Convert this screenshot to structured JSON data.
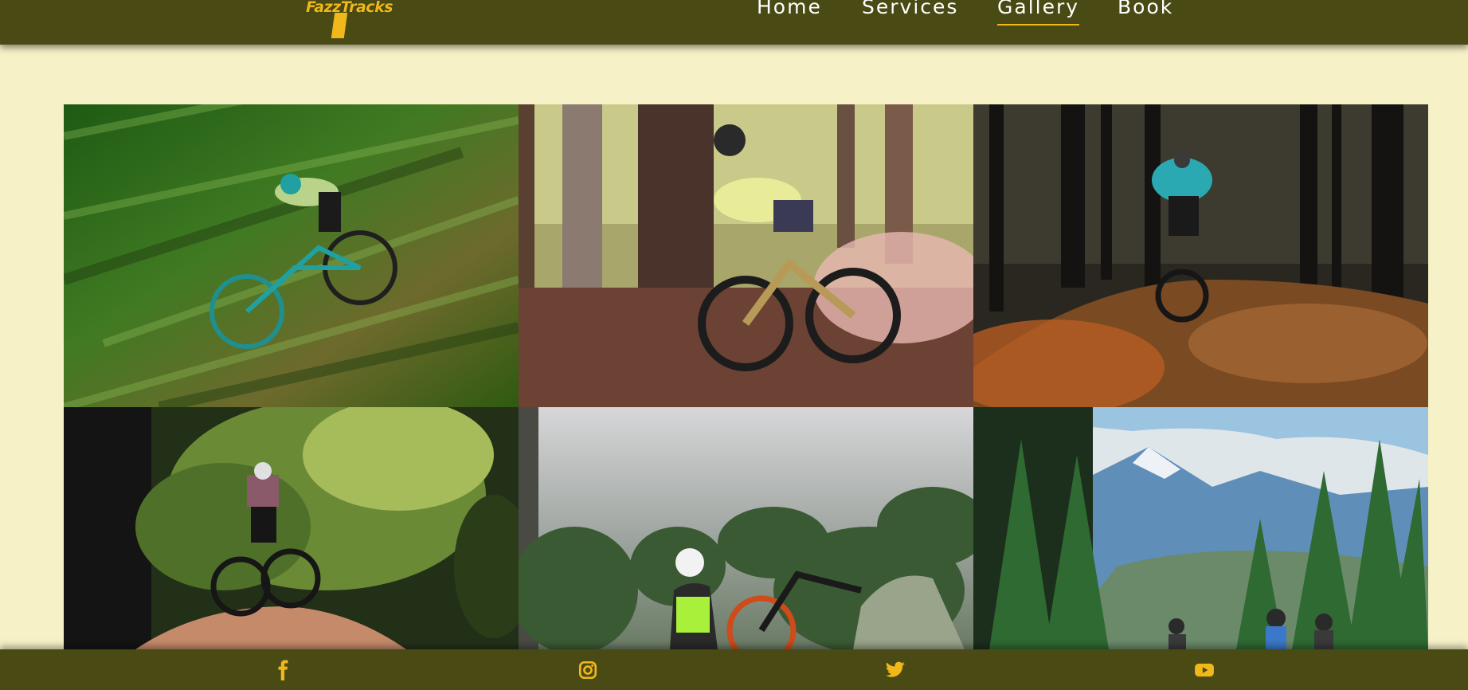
{
  "brand": {
    "logo_text": "FazzTracks",
    "accent_color": "#f0b81a",
    "bar_color": "#4a4a14",
    "background_color": "#f6f1c6"
  },
  "nav": {
    "items": [
      {
        "label": "Home",
        "active": false
      },
      {
        "label": "Services",
        "active": false
      },
      {
        "label": "Gallery",
        "active": true
      },
      {
        "label": "Book",
        "active": false
      }
    ]
  },
  "gallery": {
    "photos": [
      {
        "subject": "mountain biker jumping through blurred green forest"
      },
      {
        "subject": "mountain biker cornering on leafy trail kicking up dust"
      },
      {
        "subject": "mountain biker riding dirt trail in dark pine forest"
      },
      {
        "subject": "mountain biker dropping off a dirt mound among green trees"
      },
      {
        "subject": "biker resting beside orange mountain bike on a misty hilltop"
      },
      {
        "subject": "mountain bikers among pine trees below a snowy mountain"
      }
    ]
  },
  "footer": {
    "icons": [
      "facebook-icon",
      "instagram-icon",
      "twitter-icon",
      "youtube-icon"
    ]
  }
}
